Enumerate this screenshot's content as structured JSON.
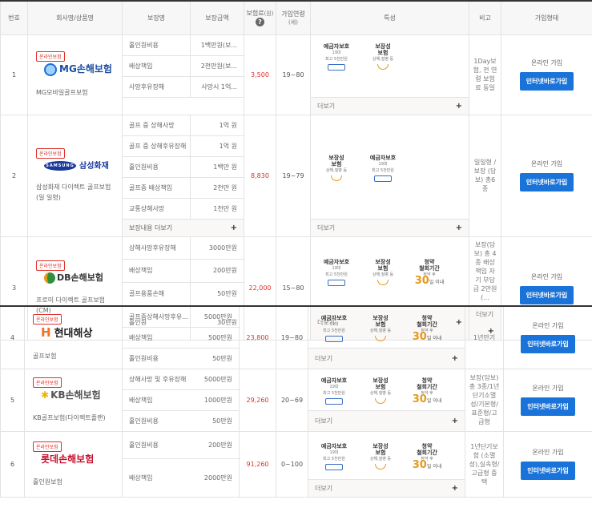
{
  "header": {
    "col_no": "번호",
    "col_company": "회사명/상품명",
    "col_coverage": "보장명",
    "col_amount": "보장금액",
    "col_premium": "보험료",
    "col_premium_unit": "(원)",
    "col_age": "가입연령",
    "col_age_unit": "(세)",
    "col_features": "특성",
    "col_note": "비고",
    "col_join": "가입형태"
  },
  "common": {
    "online_join": "온라인 가입",
    "join_button": "인터넷바로가입",
    "more": "더보기",
    "more_coverage": "보장내용 더보기",
    "direct_badge": "온라인보험",
    "feature_icons": {
      "deposit_title": "예금자보호",
      "deposit_sub": "19대",
      "deposit_sub2": "최고 5천만원",
      "cov_title": "보장성",
      "cov_title2": "보험",
      "cov_sub": "상해,질병 등",
      "withdraw_title": "청약",
      "withdraw_title2": "철회기간",
      "withdraw_sub": "청약 후",
      "withdraw_num": "30",
      "withdraw_unit": "일 이내"
    }
  },
  "rows": [
    {
      "no": "1",
      "company": "MG손해보험",
      "product": "MG모바일골프보험",
      "coverages": [
        {
          "name": "홀인원비용",
          "amount": "1백만원(보..."
        },
        {
          "name": "배상책임",
          "amount": "2천만원(보..."
        },
        {
          "name": "사망후유장해",
          "amount": "사망시 1억..."
        }
      ],
      "premium": "3,500",
      "age": "19~80",
      "note": "1Day보험, 전 연령 보험료 동일"
    },
    {
      "no": "2",
      "company": "삼성화재",
      "company_mark": "SAMSUNG",
      "product": "삼성화재 다이렉트 골프보험(일 일형)",
      "coverages": [
        {
          "name": "골프 중 상해사망",
          "amount": "1억 원"
        },
        {
          "name": "골프 중 상해후유장해",
          "amount": "1억 원"
        },
        {
          "name": "홀인원비용",
          "amount": "1백만 원"
        },
        {
          "name": "골프중 배상책임",
          "amount": "2천만 원"
        },
        {
          "name": "교통상해사망",
          "amount": "1천만 원"
        }
      ],
      "premium": "8,830",
      "age": "19~79",
      "note": "일일형 / 보장 (담보) 총6종"
    },
    {
      "no": "3",
      "company": "DB손해보험",
      "product": "프로미 다이렉트 골프보험(CM)",
      "coverages": [
        {
          "name": "상해사망후유장해",
          "amount": "3000만원"
        },
        {
          "name": "배상책임",
          "amount": "200만원"
        },
        {
          "name": "골프용품손해",
          "amount": "50만원"
        },
        {
          "name": "홀인원",
          "amount": "30만원"
        }
      ],
      "premium": "22,000",
      "age": "15~80",
      "note": "보장(담보) 총 4종 배상책임 자기 부담금 2만원(..."
    },
    {
      "no": "4",
      "company": "현대해상",
      "product": "골프보험",
      "coverages": [
        {
          "name": "골프중상해사망후유...",
          "amount": "5000만원"
        },
        {
          "name": "배상책임",
          "amount": "500만원"
        },
        {
          "name": "홀인원비용",
          "amount": "50만원"
        }
      ],
      "premium": "23,800",
      "age": "19~80",
      "note": "1년만기"
    },
    {
      "no": "5",
      "company": "KB손해보험",
      "product": "KB골프보험(다이렉트플랜)",
      "coverages": [
        {
          "name": "상해사망 및 후유장해",
          "amount": "5000만원"
        },
        {
          "name": "배상책임",
          "amount": "1000만원"
        },
        {
          "name": "홀인원비용",
          "amount": "50만원"
        }
      ],
      "premium": "29,260",
      "age": "20~69",
      "note": "보장(담보) 총 3종/1년 단기소멸성/기본형/표준형/고급형"
    },
    {
      "no": "6",
      "company": "롯데손해보험",
      "product": "홀인원보험",
      "coverages": [
        {
          "name": "홀인원비용",
          "amount": "200만원"
        },
        {
          "name": "배상책임",
          "amount": "2000만원"
        }
      ],
      "premium": "91,260",
      "age": "0~100",
      "note": "1년단기보험 (소멸성),실속형/고급형 중 택"
    }
  ],
  "colors": {
    "accent": "#1a73d9",
    "premium": "#e0302a",
    "badge": "#e0302a"
  }
}
